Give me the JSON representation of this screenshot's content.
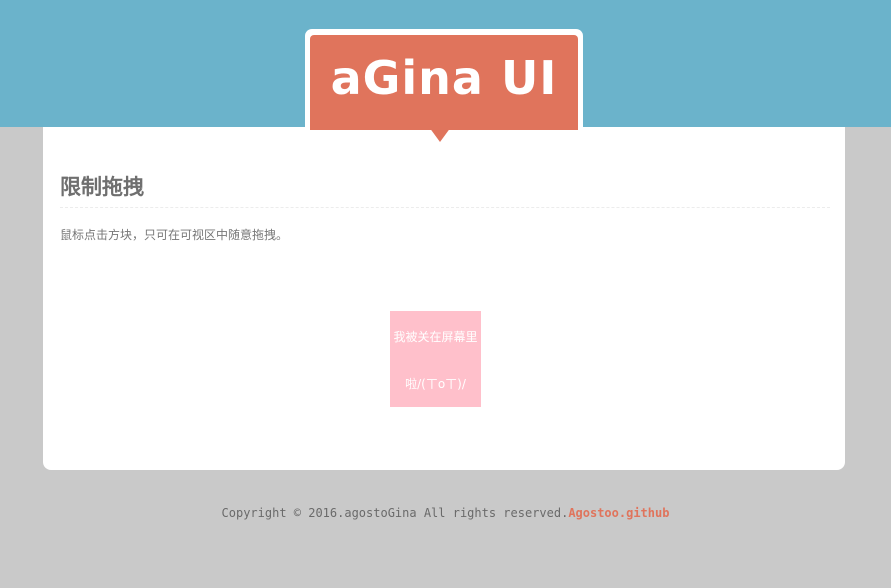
{
  "header": {
    "logo_text": "aGina UI",
    "colors": {
      "bar": "#6bb3cb",
      "logo": "#e0745c"
    }
  },
  "section": {
    "title": "限制拖拽",
    "description": "鼠标点击方块，只可在可视区中随意拖拽。"
  },
  "drag_box": {
    "line1": "我被关在屏幕里",
    "line2": "啦/(ㄒoㄒ)/",
    "color": "#ffc0cb"
  },
  "footer": {
    "copyright": "Copyright © 2016.agostoGina All rights reserved.",
    "link_text": "Agostoo.github"
  }
}
